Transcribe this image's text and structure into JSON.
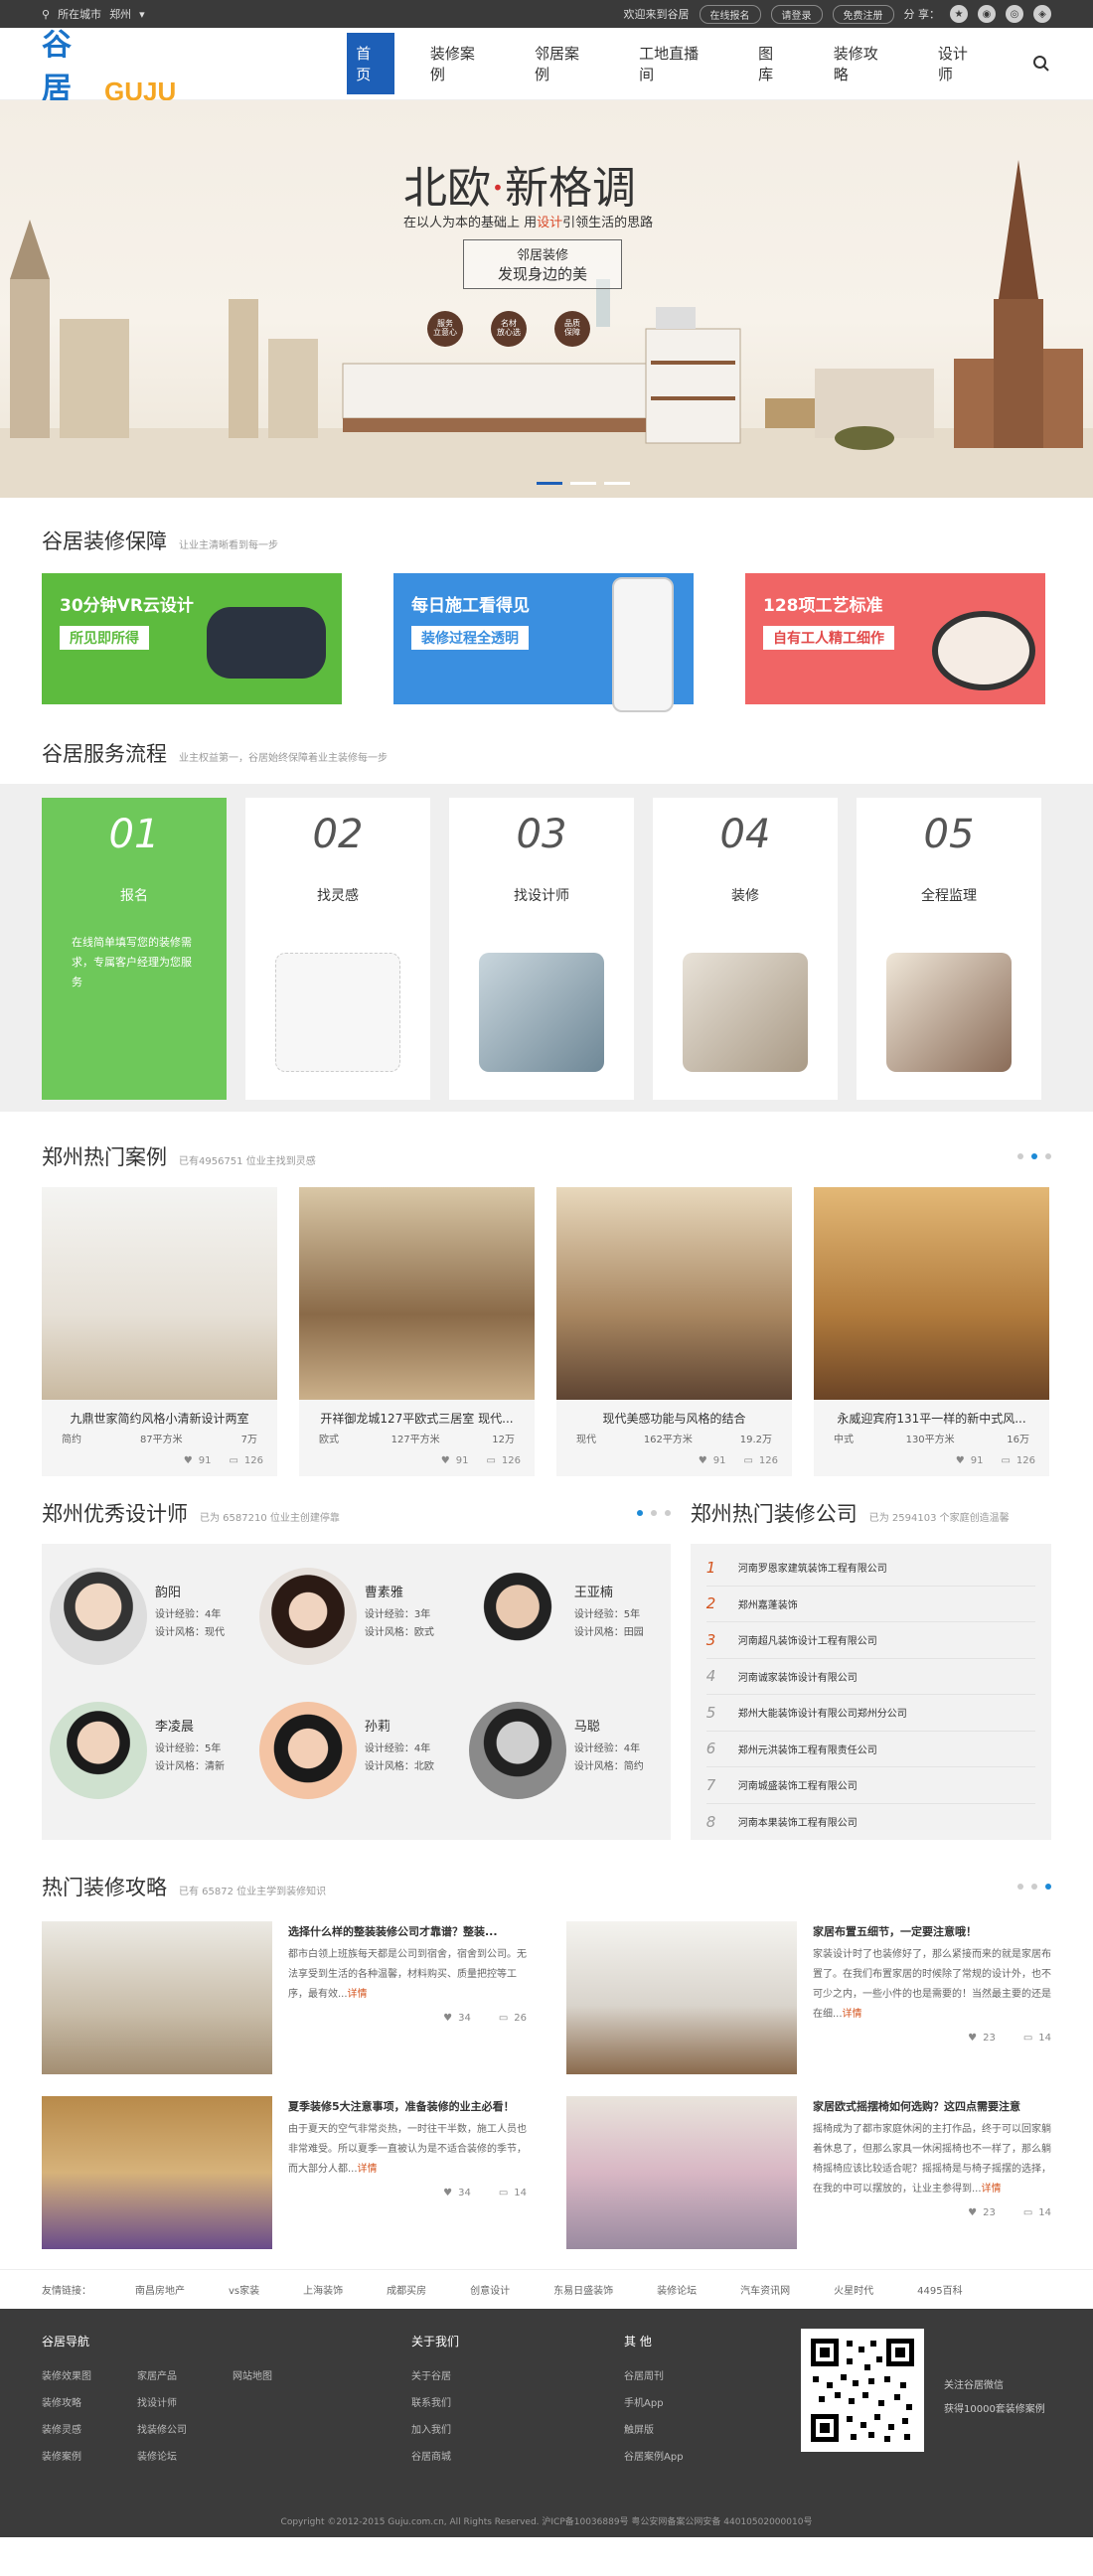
{
  "topbar": {
    "location_label": "所在城市",
    "city": "郑州",
    "welcome": "欢迎来到谷居",
    "btn_online": "在线报名",
    "btn_login": "请登录",
    "btn_register": "免费注册",
    "share": "分 享："
  },
  "header": {
    "logo_cn": "谷居",
    "logo_en": "GUJU",
    "nav": [
      "首页",
      "装修案例",
      "邻居案例",
      "工地直播间",
      "图库",
      "装修攻略",
      "设计师"
    ]
  },
  "banner": {
    "title_a": "北欧",
    "title_dot": "·",
    "title_b": "新格调",
    "subtitle_a": "在以人为本的基础上 用",
    "subtitle_hl": "设计",
    "subtitle_b": "引领生活的思路",
    "box_line1": "邻居装修",
    "box_line2": "发现身边的美",
    "circles": [
      "服务\n立意心",
      "名材\n放心选",
      "品质\n保障"
    ]
  },
  "guarantee": {
    "title": "谷居装修保障",
    "subtitle": "让业主清晰看到每一步",
    "cards": [
      {
        "title": "30分钟VR云设计",
        "badge": "所见即所得",
        "color": "#5dbb3e",
        "badge_color": "#5dbb3e"
      },
      {
        "title": "每日施工看得见",
        "badge": "装修过程全透明",
        "color": "#3a8fe0",
        "badge_color": "#3a8fe0"
      },
      {
        "title": "128项工艺标准",
        "badge": "自有工人精工细作",
        "color": "#f06565",
        "badge_color": "#e24a4a"
      }
    ]
  },
  "flow": {
    "title": "谷居服务流程",
    "subtitle": "业主权益第一，谷居始终保障着业主装修每一步",
    "steps": [
      {
        "num": "01",
        "label": "报名",
        "desc": "在线简单填写您的装修需求，专属客户经理为您服务"
      },
      {
        "num": "02",
        "label": "找灵感"
      },
      {
        "num": "03",
        "label": "找设计师"
      },
      {
        "num": "04",
        "label": "装修"
      },
      {
        "num": "05",
        "label": "全程监理"
      }
    ]
  },
  "cases": {
    "title": "郑州热门案例",
    "subtitle": "已有4956751 位业主找到灵感",
    "items": [
      {
        "title": "九鼎世家简约风格小清新设计两室",
        "style": "简约",
        "area": "87平方米",
        "price": "7万",
        "likes": "91",
        "comments": "126"
      },
      {
        "title": "开祥御龙城127平欧式三居室 现代...",
        "style": "欧式",
        "area": "127平方米",
        "price": "12万",
        "likes": "91",
        "comments": "126"
      },
      {
        "title": "现代美感功能与风格的结合",
        "style": "现代",
        "area": "162平方米",
        "price": "19.2万",
        "likes": "91",
        "comments": "126"
      },
      {
        "title": "永威迎宾府131平一样的新中式风...",
        "style": "中式",
        "area": "130平方米",
        "price": "16万",
        "likes": "91",
        "comments": "126"
      }
    ]
  },
  "designers": {
    "title": "郑州优秀设计师",
    "subtitle": "已为 6587210 位业主创建停靠",
    "items": [
      {
        "name": "韵阳",
        "exp": "设计经验：4年",
        "style": "设计风格：现代"
      },
      {
        "name": "曹素雅",
        "exp": "设计经验：3年",
        "style": "设计风格：欧式"
      },
      {
        "name": "王亚楠",
        "exp": "设计经验：5年",
        "style": "设计风格：田园"
      },
      {
        "name": "李凌晨",
        "exp": "设计经验：5年",
        "style": "设计风格：清新"
      },
      {
        "name": "孙莉",
        "exp": "设计经验：4年",
        "style": "设计风格：北欧"
      },
      {
        "name": "马聪",
        "exp": "设计经验：4年",
        "style": "设计风格：简约"
      }
    ]
  },
  "companies": {
    "title": "郑州热门装修公司",
    "subtitle": "已为 2594103 个家庭创造温馨",
    "items": [
      "河南罗恩家建筑装饰工程有限公司",
      "郑州嘉蓬装饰",
      "河南超凡装饰设计工程有限公司",
      "河南诚家装饰设计有限公司",
      "郑州大能装饰设计有限公司郑州分公司",
      "郑州元洪装饰工程有限责任公司",
      "河南城盛装饰工程有限公司",
      "河南本果装饰工程有限公司"
    ]
  },
  "guides": {
    "title": "热门装修攻略",
    "subtitle": "已有 65872 位业主学到装修知识",
    "items": [
      {
        "title": "选择什么样的整装装修公司才靠谱？整装...",
        "body": "都市白领上班族每天都是公司到宿舍，宿舍到公司。无法享受到生活的各种温馨，材料购买、质量把控等工序，最有效...",
        "more": "详情",
        "likes": "34",
        "comments": "26"
      },
      {
        "title": "家居布置五细节，一定要注意哦！",
        "body": "家装设计时了也装修好了，那么紧接而来的就是家居布置了。在我们布置家居的时候除了常规的设计外，也不可少之内，一些小件的也是需要的！当然最主要的还是在细...",
        "more": "详情",
        "likes": "23",
        "comments": "14"
      },
      {
        "title": "夏季装修5大注意事项，准备装修的业主必看！",
        "body": "由于夏天的空气非常炎热，一时往干半数，施工人员也非常难受。所以夏季一直被认为是不适合装修的季节，而大部分人都...",
        "more": "详情",
        "likes": "34",
        "comments": "14"
      },
      {
        "title": "家居欧式摇摆椅如何选购？这四点需要注意",
        "body": "摇椅成为了都市家庭休闲的主打作品，终于可以回家躺着休息了，但那么家具一休闲摇椅也不一样了，那么躺椅摇椅应该比较适合呢？摇摇椅是与椅子摇摆的选择，在我的中可以摆放的，让业主参得到...",
        "more": "详情",
        "likes": "23",
        "comments": "14"
      }
    ]
  },
  "friend_links": {
    "label": "友情链接：",
    "items": [
      "南昌房地产",
      "vs家装",
      "上海装饰",
      "成都买房",
      "创意设计",
      "东易日盛装饰",
      "装修论坛",
      "汽车资讯网",
      "火星时代",
      "4495百科"
    ]
  },
  "footer": {
    "col1_title": "谷居导航",
    "col1": [
      [
        "装修效果图",
        "家居产品",
        "网站地图"
      ],
      [
        "装修攻略",
        "找设计师"
      ],
      [
        "装修灵感",
        "找装修公司"
      ],
      [
        "装修案例",
        "装修论坛"
      ]
    ],
    "col2_title": "关于我们",
    "col2": [
      "关于谷居",
      "联系我们",
      "加入我们",
      "谷居商城"
    ],
    "col3_title": "其 他",
    "col3": [
      "谷居周刊",
      "手机App",
      "触屏版",
      "谷居案例App"
    ],
    "qr_text1": "关注谷居微信",
    "qr_text2": "获得10000套装修案例",
    "copyright": "Copyright ©2012-2015 Guju.com.cn, All Rights Reserved. 沪ICP备10036889号 粤公安网备案公网安备 44010502000010号"
  }
}
